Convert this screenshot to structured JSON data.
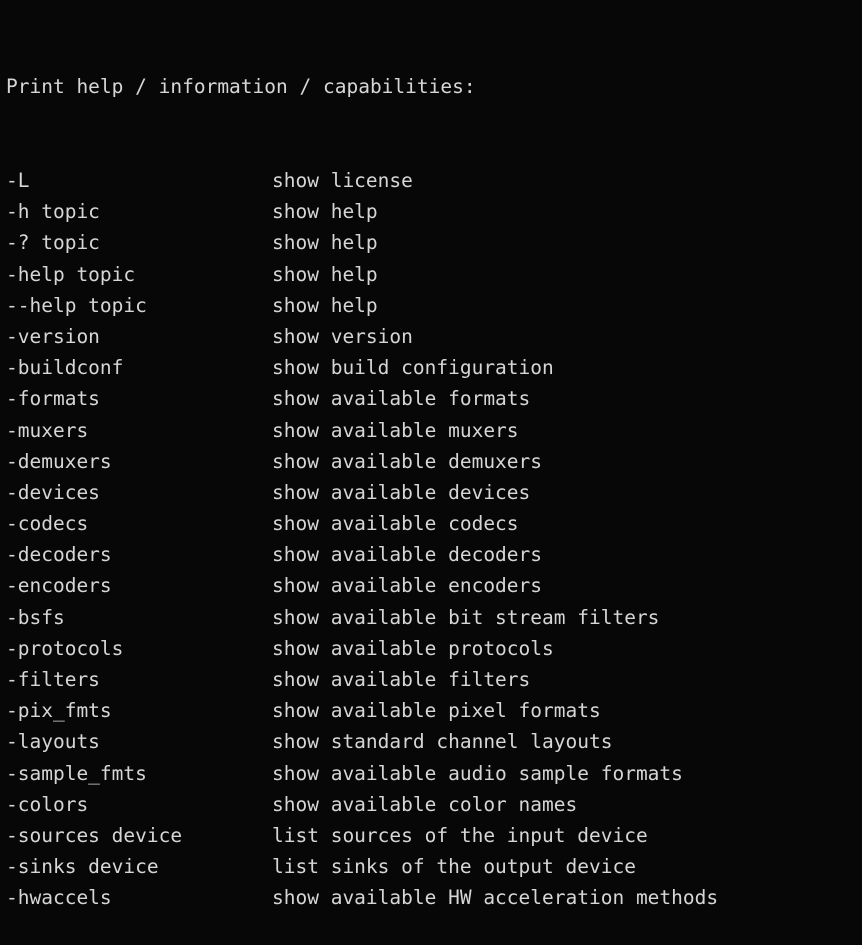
{
  "terminal": {
    "background_color": "#070707",
    "text_color": "#d6d6d6",
    "header": "Print help / information / capabilities:",
    "rows": [
      {
        "option": "-L",
        "description": "show license"
      },
      {
        "option": "-h topic",
        "description": "show help"
      },
      {
        "option": "-? topic",
        "description": "show help"
      },
      {
        "option": "-help topic",
        "description": "show help"
      },
      {
        "option": "--help topic",
        "description": "show help"
      },
      {
        "option": "-version",
        "description": "show version"
      },
      {
        "option": "-buildconf",
        "description": "show build configuration"
      },
      {
        "option": "-formats",
        "description": "show available formats"
      },
      {
        "option": "-muxers",
        "description": "show available muxers"
      },
      {
        "option": "-demuxers",
        "description": "show available demuxers"
      },
      {
        "option": "-devices",
        "description": "show available devices"
      },
      {
        "option": "-codecs",
        "description": "show available codecs"
      },
      {
        "option": "-decoders",
        "description": "show available decoders"
      },
      {
        "option": "-encoders",
        "description": "show available encoders"
      },
      {
        "option": "-bsfs",
        "description": "show available bit stream filters"
      },
      {
        "option": "-protocols",
        "description": "show available protocols"
      },
      {
        "option": "-filters",
        "description": "show available filters"
      },
      {
        "option": "-pix_fmts",
        "description": "show available pixel formats"
      },
      {
        "option": "-layouts",
        "description": "show standard channel layouts"
      },
      {
        "option": "-sample_fmts",
        "description": "show available audio sample formats"
      },
      {
        "option": "-colors",
        "description": "show available color names"
      },
      {
        "option": "-sources device",
        "description": "list sources of the input device"
      },
      {
        "option": "-sinks device",
        "description": "list sinks of the output device"
      },
      {
        "option": "-hwaccels",
        "description": "show available HW acceleration methods"
      }
    ]
  }
}
